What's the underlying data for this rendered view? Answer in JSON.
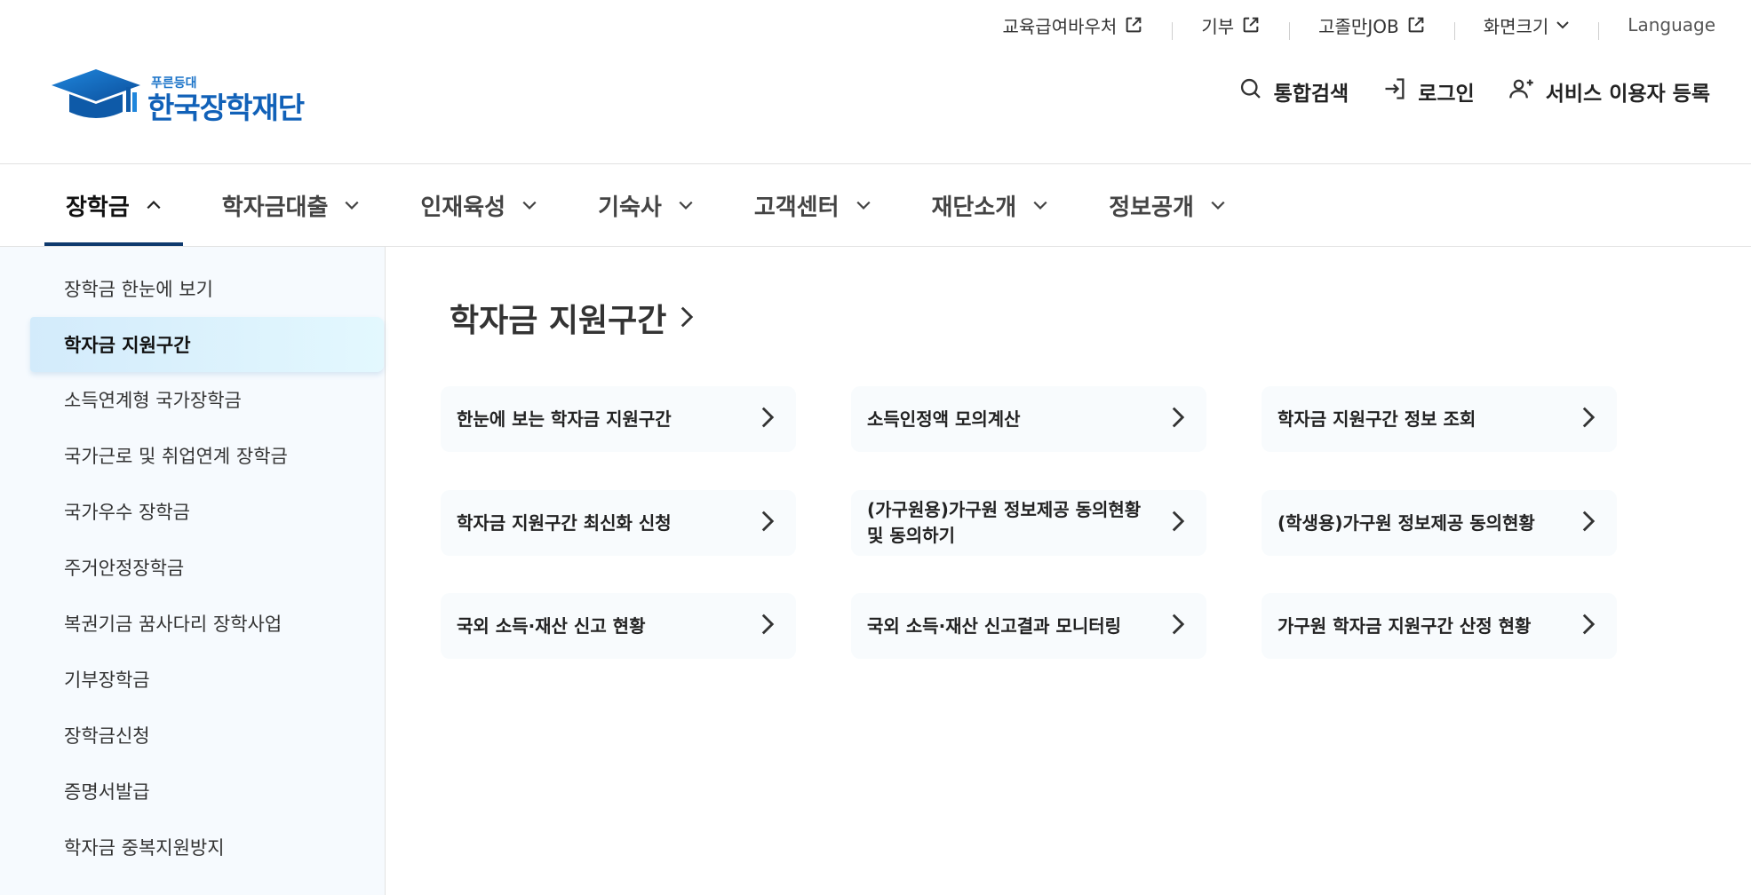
{
  "utility": {
    "items": [
      {
        "label": "교육급여바우처",
        "external": true
      },
      {
        "label": "기부",
        "external": true
      },
      {
        "label": "고졸만JOB",
        "external": true
      },
      {
        "label": "화면크기",
        "dropdown": true
      },
      {
        "label": "Language"
      }
    ]
  },
  "logo": {
    "tagline": "푸른등대",
    "name": "한국장학재단"
  },
  "header": {
    "search": "통합검색",
    "login": "로그인",
    "register": "서비스 이용자 등록"
  },
  "gnb": {
    "items": [
      {
        "label": "장학금",
        "active": true
      },
      {
        "label": "학자금대출"
      },
      {
        "label": "인재육성"
      },
      {
        "label": "기숙사"
      },
      {
        "label": "고객센터"
      },
      {
        "label": "재단소개"
      },
      {
        "label": "정보공개"
      }
    ]
  },
  "sidebar": {
    "items": [
      {
        "label": "장학금 한눈에 보기"
      },
      {
        "label": "학자금 지원구간",
        "active": true
      },
      {
        "label": "소득연계형 국가장학금"
      },
      {
        "label": "국가근로 및 취업연계 장학금"
      },
      {
        "label": "국가우수 장학금"
      },
      {
        "label": "주거안정장학금"
      },
      {
        "label": "복권기금 꿈사다리 장학사업"
      },
      {
        "label": "기부장학금"
      },
      {
        "label": "장학금신청"
      },
      {
        "label": "증명서발급"
      },
      {
        "label": "학자금 중복지원방지"
      }
    ]
  },
  "main": {
    "title": "학자금 지원구간",
    "cards": [
      {
        "label": "한눈에 보는 학자금 지원구간"
      },
      {
        "label": "소득인정액 모의계산"
      },
      {
        "label": "학자금 지원구간 정보 조회"
      },
      {
        "label": "학자금 지원구간 최신화 신청"
      },
      {
        "label": "(가구원용)가구원 정보제공 동의현황 및 동의하기"
      },
      {
        "label": "(학생용)가구원 정보제공 동의현황"
      },
      {
        "label": "국외 소득·재산 신고 현황"
      },
      {
        "label": "국외 소득·재산 신고결과 모니터링"
      },
      {
        "label": "가구원 학자금 지원구간 산정 현황"
      }
    ]
  },
  "colors": {
    "brand": "#1161b8",
    "active_underline": "#0e3a6e",
    "sidebar_bg": "#f6fafe",
    "card_bg": "#f8fbfd"
  }
}
